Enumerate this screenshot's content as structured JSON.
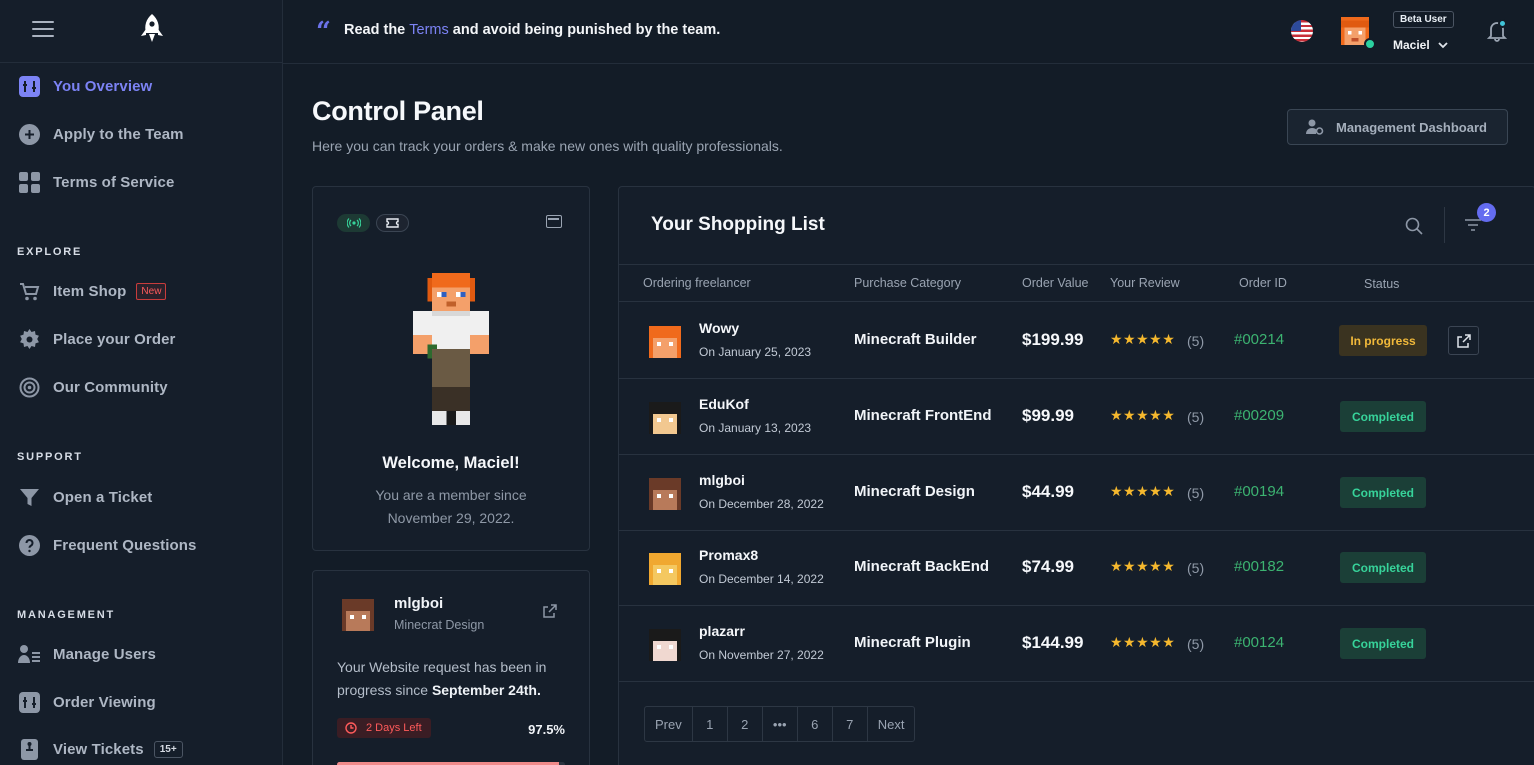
{
  "sidebar": {
    "items": [
      {
        "label": "You Overview",
        "icon": "overview-icon",
        "active": true
      },
      {
        "label": "Apply to the Team",
        "icon": "plus-circle-icon"
      },
      {
        "label": "Terms of Service",
        "icon": "grid-icon"
      }
    ],
    "explore": {
      "title": "EXPLORE",
      "items": [
        {
          "label": "Item Shop",
          "icon": "cart-icon",
          "badge": "New"
        },
        {
          "label": "Place your Order",
          "icon": "gear-icon"
        },
        {
          "label": "Our Community",
          "icon": "broadcast-icon"
        }
      ]
    },
    "support": {
      "title": "SUPPORT",
      "items": [
        {
          "label": "Open a Ticket",
          "icon": "funnel-icon"
        },
        {
          "label": "Frequent Questions",
          "icon": "question-icon"
        }
      ]
    },
    "management": {
      "title": "MANAGEMENT",
      "items": [
        {
          "label": "Manage Users",
          "icon": "users-list-icon"
        },
        {
          "label": "Order Viewing",
          "icon": "overview-icon"
        },
        {
          "label": "View Tickets",
          "icon": "ticket-icon",
          "badge": "15+"
        }
      ]
    }
  },
  "topbar": {
    "notice_pre": "Read the",
    "notice_link": "Terms",
    "notice_post": "and avoid being punished by the team.",
    "user_role": "Beta User",
    "user_name": "Maciel"
  },
  "header": {
    "title": "Control Panel",
    "subtitle": "Here you can track your orders & make new ones with quality professionals.",
    "mgmt_button": "Management Dashboard"
  },
  "profile": {
    "welcome": "Welcome, Maciel!",
    "member_line1": "You are a member since",
    "member_line2": "November 29, 2022."
  },
  "request": {
    "name": "mlgboi",
    "category": "Minecrat Design",
    "text_pre": "Your Website request has been in progress since",
    "text_bold": "September 24th.",
    "days_left": "2 Days Left",
    "percent": "97.5%",
    "progress": 0.975
  },
  "shopping": {
    "title": "Your Shopping List",
    "filter_count": "2",
    "headers": {
      "freelancer": "Ordering freelancer",
      "category": "Purchase Category",
      "value": "Order Value",
      "review": "Your Review",
      "order_id": "Order ID",
      "status": "Status"
    },
    "rows": [
      {
        "name": "Wowy",
        "date": "On January 25, 2023",
        "category": "Minecraft Builder",
        "value": "$199.99",
        "stars": "★★★★★",
        "reviews": "(5)",
        "order_id": "#00214",
        "status": "In progress",
        "skin_hair": "#f06a1c",
        "skin_face": "#f4a06a"
      },
      {
        "name": "EduKof",
        "date": "On January 13, 2023",
        "category": "Minecraft FrontEnd",
        "value": "$99.99",
        "stars": "★★★★★",
        "reviews": "(5)",
        "order_id": "#00209",
        "status": "Completed",
        "skin_hair": "#1a1a1a",
        "skin_face": "#f2c890"
      },
      {
        "name": "mlgboi",
        "date": "On December 28, 2022",
        "category": "Minecraft Design",
        "value": "$44.99",
        "stars": "★★★★★",
        "reviews": "(5)",
        "order_id": "#00194",
        "status": "Completed",
        "skin_hair": "#6a3a28",
        "skin_face": "#b87a5a"
      },
      {
        "name": "Promax8",
        "date": "On December 14, 2022",
        "category": "Minecraft BackEnd",
        "value": "$74.99",
        "stars": "★★★★★",
        "reviews": "(5)",
        "order_id": "#00182",
        "status": "Completed",
        "skin_hair": "#f0a830",
        "skin_face": "#f4c860"
      },
      {
        "name": "plazarr",
        "date": "On November 27, 2022",
        "category": "Minecraft Plugin",
        "value": "$144.99",
        "stars": "★★★★★",
        "reviews": "(5)",
        "order_id": "#00124",
        "status": "Completed",
        "skin_hair": "#1a1a1a",
        "skin_face": "#f0d8d0"
      }
    ],
    "pager": [
      "Prev",
      "1",
      "2",
      "•••",
      "6",
      "7",
      "Next"
    ]
  },
  "colors": {
    "accent": "#7c83f5",
    "success": "#37d39a",
    "warning": "#f1b93a",
    "danger": "#ff5b5b"
  }
}
